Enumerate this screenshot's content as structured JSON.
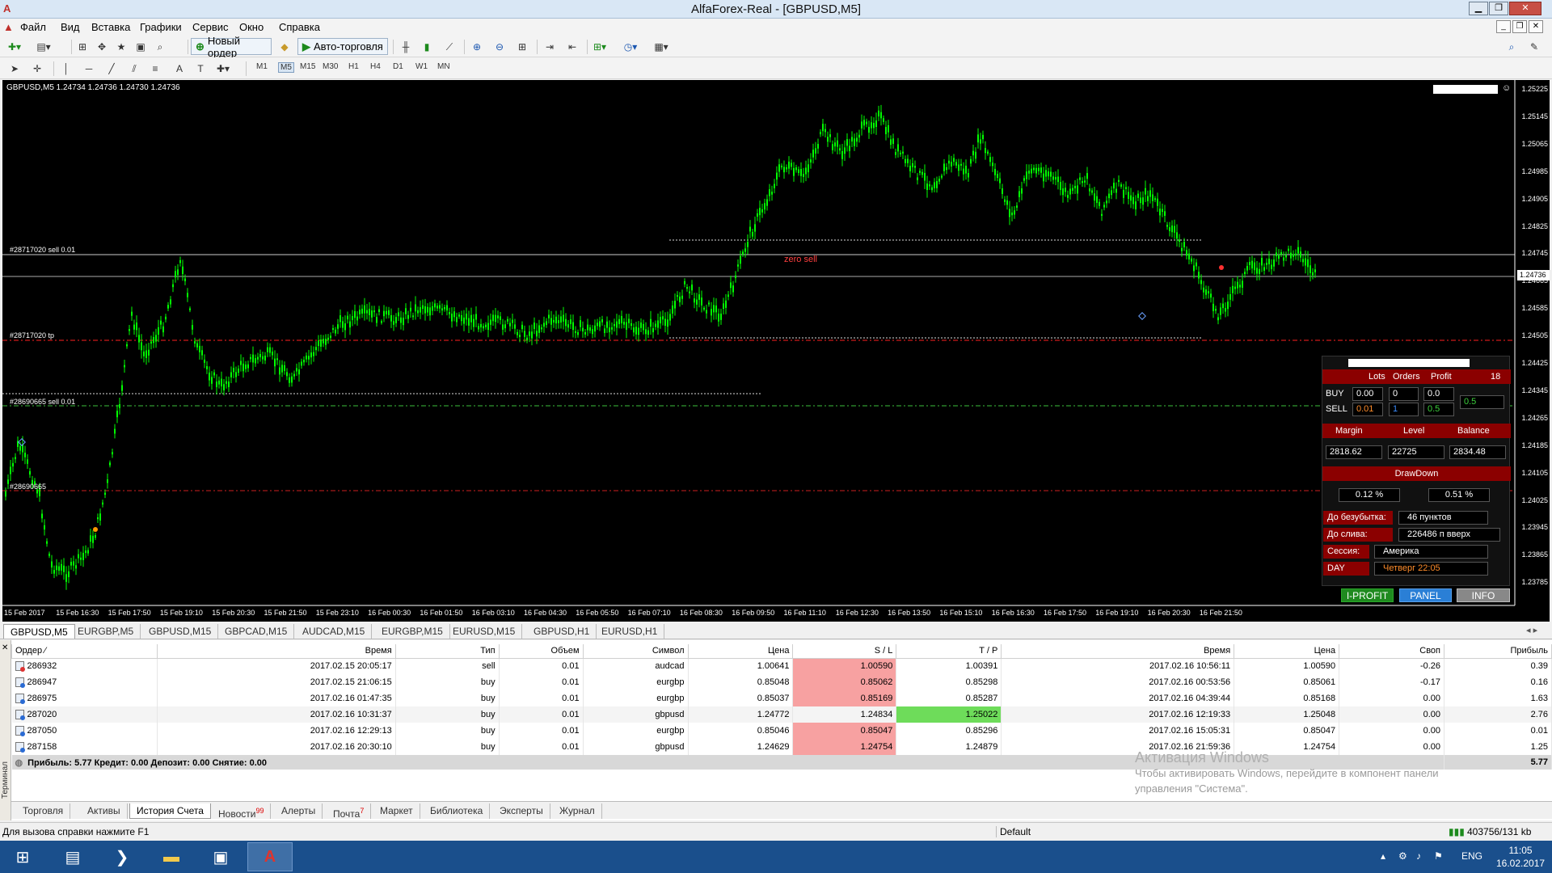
{
  "window": {
    "title": "AlfaForex-Real - [GBPUSD,M5]",
    "app_icon": "alfa-logo"
  },
  "menu": {
    "items": [
      "Файл",
      "Вид",
      "Вставка",
      "Графики",
      "Сервис",
      "Окно",
      "Справка"
    ]
  },
  "toolbar": {
    "new_order": "Новый ордер",
    "auto_trading": "Авто-торговля",
    "timeframes": [
      "M1",
      "M5",
      "M15",
      "M30",
      "H1",
      "H4",
      "D1",
      "W1",
      "MN"
    ],
    "active_timeframe": "M5"
  },
  "chart": {
    "info": "GBPUSD,M5  1.24734 1.24736 1.24730 1.24736",
    "current_price": "1.24736",
    "labels": {
      "sell_line": "#28717020 sell 0.01",
      "tp_line": "#28717020 tp",
      "sell_line2": "#28690665 sell 0.01",
      "tp_line2": "#28690665",
      "zero_sell": "zero sell"
    },
    "price_axis": [
      "1.25225",
      "1.25145",
      "1.25065",
      "1.24985",
      "1.24905",
      "1.24825",
      "1.24745",
      "1.24665",
      "1.24585",
      "1.24505",
      "1.24425",
      "1.24345",
      "1.24265",
      "1.24185",
      "1.24105",
      "1.24025",
      "1.23945",
      "1.23865",
      "1.23785"
    ],
    "time_axis": [
      "15 Feb 2017",
      "15 Feb 16:30",
      "15 Feb 17:50",
      "15 Feb 19:10",
      "15 Feb 20:30",
      "15 Feb 21:50",
      "15 Feb 23:10",
      "16 Feb 00:30",
      "16 Feb 01:50",
      "16 Feb 03:10",
      "16 Feb 04:30",
      "16 Feb 05:50",
      "16 Feb 07:10",
      "16 Feb 08:30",
      "16 Feb 09:50",
      "16 Feb 11:10",
      "16 Feb 12:30",
      "16 Feb 13:50",
      "16 Feb 15:10",
      "16 Feb 16:30",
      "16 Feb 17:50",
      "16 Feb 19:10",
      "16 Feb 20:30",
      "16 Feb 21:50"
    ],
    "colors": {
      "background": "#000000",
      "candles": "#00ff00",
      "sell_line": "#ffffff",
      "tp_line": "#ff2020",
      "green_dash": "#3cc03c"
    }
  },
  "panel": {
    "headers": {
      "lots": "Lots",
      "orders": "Orders",
      "profit": "Profit",
      "count": "18"
    },
    "buy": {
      "label": "BUY",
      "lots": "0.00",
      "orders": "0",
      "profit": "0.0"
    },
    "sell": {
      "label": "SELL",
      "lots": "0.01",
      "orders": "1",
      "profit": "0.5"
    },
    "total_profit": "0.5",
    "account_headers": {
      "margin": "Margin",
      "level": "Level",
      "balance": "Balance"
    },
    "account": {
      "margin": "2818.62",
      "level": "22725",
      "balance": "2834.48"
    },
    "drawdown": {
      "label": "DrawDown",
      "v1": "0.12 %",
      "v2": "0.51 %"
    },
    "info_rows": [
      {
        "label": "До безубытка:",
        "value": "46 пунктов"
      },
      {
        "label": "До слива:",
        "value": "226486 п вверх"
      },
      {
        "label": "Сессия:",
        "value": "Америка"
      },
      {
        "label": "DAY",
        "value": "Четверг  22:05"
      }
    ],
    "buttons": {
      "iprofit": "I-PROFIT",
      "panel": "PANEL",
      "info": "INFO"
    }
  },
  "chart_tabs": [
    "GBPUSD,M5",
    "EURGBP,M5",
    "GBPUSD,M15",
    "GBPCAD,M15",
    "AUDCAD,M15",
    "EURGBP,M15",
    "EURUSD,M15",
    "GBPUSD,H1",
    "EURUSD,H1"
  ],
  "history": {
    "columns": [
      "Ордер",
      "Время",
      "Тип",
      "Объем",
      "Символ",
      "Цена",
      "S / L",
      "T / P",
      "Время",
      "Цена",
      "Своп",
      "Прибыль"
    ],
    "rows": [
      {
        "order": "286932",
        "time": "2017.02.15 20:05:17",
        "type": "sell",
        "volume": "0.01",
        "symbol": "audcad",
        "price": "1.00641",
        "sl": "1.00590",
        "tp": "1.00391",
        "close_time": "2017.02.16 10:56:11",
        "close_price": "1.00590",
        "swap": "-0.26",
        "profit": "0.39",
        "sl_hl": "red",
        "tp_hl": "none"
      },
      {
        "order": "286947",
        "time": "2017.02.15 21:06:15",
        "type": "buy",
        "volume": "0.01",
        "symbol": "eurgbp",
        "price": "0.85048",
        "sl": "0.85062",
        "tp": "0.85298",
        "close_time": "2017.02.16 00:53:56",
        "close_price": "0.85061",
        "swap": "-0.17",
        "profit": "0.16",
        "sl_hl": "red",
        "tp_hl": "none"
      },
      {
        "order": "286975",
        "time": "2017.02.16 01:47:35",
        "type": "buy",
        "volume": "0.01",
        "symbol": "eurgbp",
        "price": "0.85037",
        "sl": "0.85169",
        "tp": "0.85287",
        "close_time": "2017.02.16 04:39:44",
        "close_price": "0.85168",
        "swap": "0.00",
        "profit": "1.63",
        "sl_hl": "red",
        "tp_hl": "none"
      },
      {
        "order": "287020",
        "time": "2017.02.16 10:31:37",
        "type": "buy",
        "volume": "0.01",
        "symbol": "gbpusd",
        "price": "1.24772",
        "sl": "1.24834",
        "tp": "1.25022",
        "close_time": "2017.02.16 12:19:33",
        "close_price": "1.25048",
        "swap": "0.00",
        "profit": "2.76",
        "sl_hl": "none",
        "tp_hl": "green"
      },
      {
        "order": "287050",
        "time": "2017.02.16 12:29:13",
        "type": "buy",
        "volume": "0.01",
        "symbol": "eurgbp",
        "price": "0.85046",
        "sl": "0.85047",
        "tp": "0.85296",
        "close_time": "2017.02.16 15:05:31",
        "close_price": "0.85047",
        "swap": "0.00",
        "profit": "0.01",
        "sl_hl": "red",
        "tp_hl": "none"
      },
      {
        "order": "287158",
        "time": "2017.02.16 20:30:10",
        "type": "buy",
        "volume": "0.01",
        "symbol": "gbpusd",
        "price": "1.24629",
        "sl": "1.24754",
        "tp": "1.24879",
        "close_time": "2017.02.16 21:59:36",
        "close_price": "1.24754",
        "swap": "0.00",
        "profit": "1.25",
        "sl_hl": "red",
        "tp_hl": "none"
      }
    ],
    "summary": "Прибыль: 5.77  Кредит: 0.00  Депозит: 0.00  Снятие: 0.00",
    "total": "5.77"
  },
  "activation": {
    "title": "Активация Windows",
    "line1": "Чтобы активировать Windows, перейдите в компонент панели",
    "line2": "управления \"Система\"."
  },
  "terminal": {
    "side_label": "Терминал",
    "tabs": [
      "Торговля",
      "Активы",
      "История Счета",
      "Новости",
      "Алерты",
      "Почта",
      "Маркет",
      "Библиотека",
      "Эксперты",
      "Журнал"
    ],
    "active_tab": "История Счета",
    "news_badge": "99",
    "mail_badge": "7"
  },
  "status": {
    "help": "Для вызова справки нажмите F1",
    "profile": "Default",
    "traffic": "403756/131 kb"
  },
  "taskbar": {
    "time": "11:05",
    "date": "16.02.2017",
    "lang": "ENG"
  }
}
